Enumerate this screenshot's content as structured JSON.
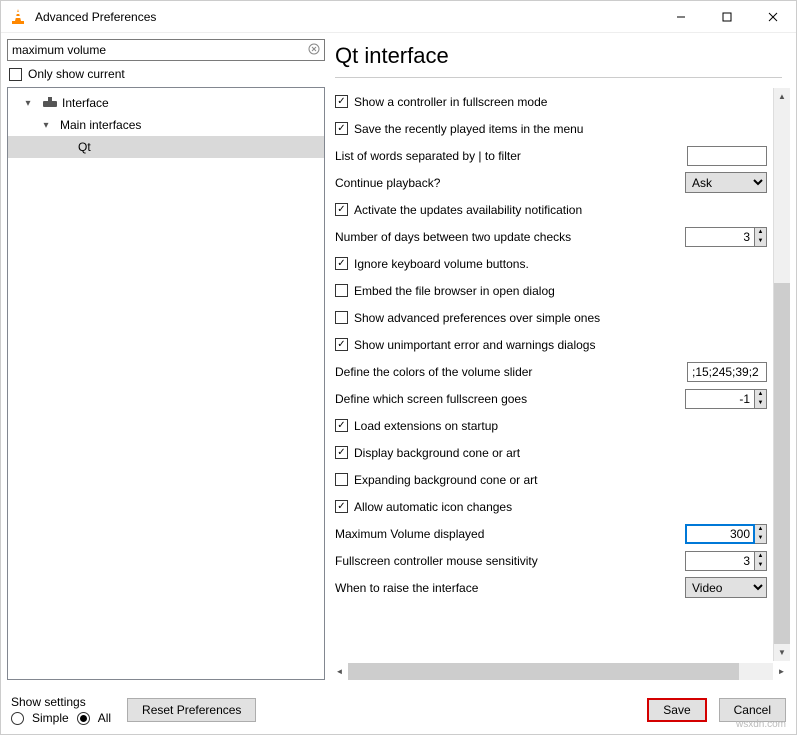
{
  "window": {
    "title": "Advanced Preferences"
  },
  "left": {
    "search_value": "maximum volume",
    "only_show_current": "Only show current",
    "tree": {
      "interface": "Interface",
      "main_interfaces": "Main interfaces",
      "qt": "Qt"
    }
  },
  "right": {
    "heading": "Qt interface",
    "rows": [
      {
        "type": "check",
        "checked": true,
        "label": "Show a controller in fullscreen mode"
      },
      {
        "type": "check",
        "checked": true,
        "label": "Save the recently played items in the menu"
      },
      {
        "type": "text",
        "label": "List of words separated by | to filter",
        "value": ""
      },
      {
        "type": "select",
        "label": "Continue playback?",
        "value": "Ask"
      },
      {
        "type": "check",
        "checked": true,
        "label": "Activate the updates availability notification"
      },
      {
        "type": "spin",
        "label": "Number of days between two update checks",
        "value": "3"
      },
      {
        "type": "check",
        "checked": true,
        "label": "Ignore keyboard volume buttons."
      },
      {
        "type": "check",
        "checked": false,
        "label": "Embed the file browser in open dialog"
      },
      {
        "type": "check",
        "checked": false,
        "label": "Show advanced preferences over simple ones"
      },
      {
        "type": "check",
        "checked": true,
        "label": "Show unimportant error and warnings dialogs"
      },
      {
        "type": "text",
        "label": "Define the colors of the volume slider",
        "value": ";15;245;39;2"
      },
      {
        "type": "spin",
        "label": "Define which screen fullscreen goes",
        "value": "-1"
      },
      {
        "type": "check",
        "checked": true,
        "label": "Load extensions on startup"
      },
      {
        "type": "check",
        "checked": true,
        "label": "Display background cone or art"
      },
      {
        "type": "check",
        "checked": false,
        "label": "Expanding background cone or art"
      },
      {
        "type": "check",
        "checked": true,
        "label": "Allow automatic icon changes"
      },
      {
        "type": "spin",
        "label": "Maximum Volume displayed",
        "value": "300",
        "hl": true
      },
      {
        "type": "spin",
        "label": "Fullscreen controller mouse sensitivity",
        "value": "3"
      },
      {
        "type": "select",
        "label": "When to raise the interface",
        "value": "Video"
      }
    ]
  },
  "footer": {
    "show_settings": "Show settings",
    "simple": "Simple",
    "all": "All",
    "reset": "Reset Preferences",
    "save": "Save",
    "cancel": "Cancel"
  },
  "watermark": "wsxdn.com"
}
